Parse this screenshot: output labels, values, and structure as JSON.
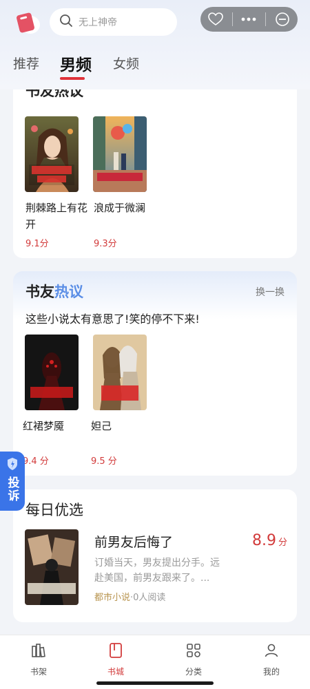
{
  "header": {
    "search_placeholder": "无上神帝",
    "tabs": [
      "推荐",
      "男频",
      "女频"
    ]
  },
  "card1": {
    "title": "书友热议",
    "books": [
      {
        "name": "荆棘路上有花开",
        "score": "9.1分"
      },
      {
        "name": "浪成于微澜",
        "score": "9.3分"
      }
    ]
  },
  "card2": {
    "title_a": "书友",
    "title_b": "热议",
    "refresh": "换一换",
    "subtitle": "这些小说太有意思了!笑的停不下来!",
    "books": [
      {
        "name": "红裙梦魇",
        "score": "9.4 分"
      },
      {
        "name": "妲己",
        "score": "9.5 分"
      }
    ]
  },
  "daily": {
    "title": "每日优选",
    "book_name": "前男友后悔了",
    "score": "8.9",
    "score_unit": "分",
    "desc": "订婚当天，男友提出分手。远赴美国，前男友跟来了。...",
    "category": "都市小说",
    "readers": "·0人阅读"
  },
  "complain": "投诉",
  "tabbar": [
    "书架",
    "书城",
    "分类",
    "我的"
  ],
  "colors": {
    "accent": "#d23b3b",
    "link": "#5b8ee6",
    "complain": "#3a74e8"
  }
}
